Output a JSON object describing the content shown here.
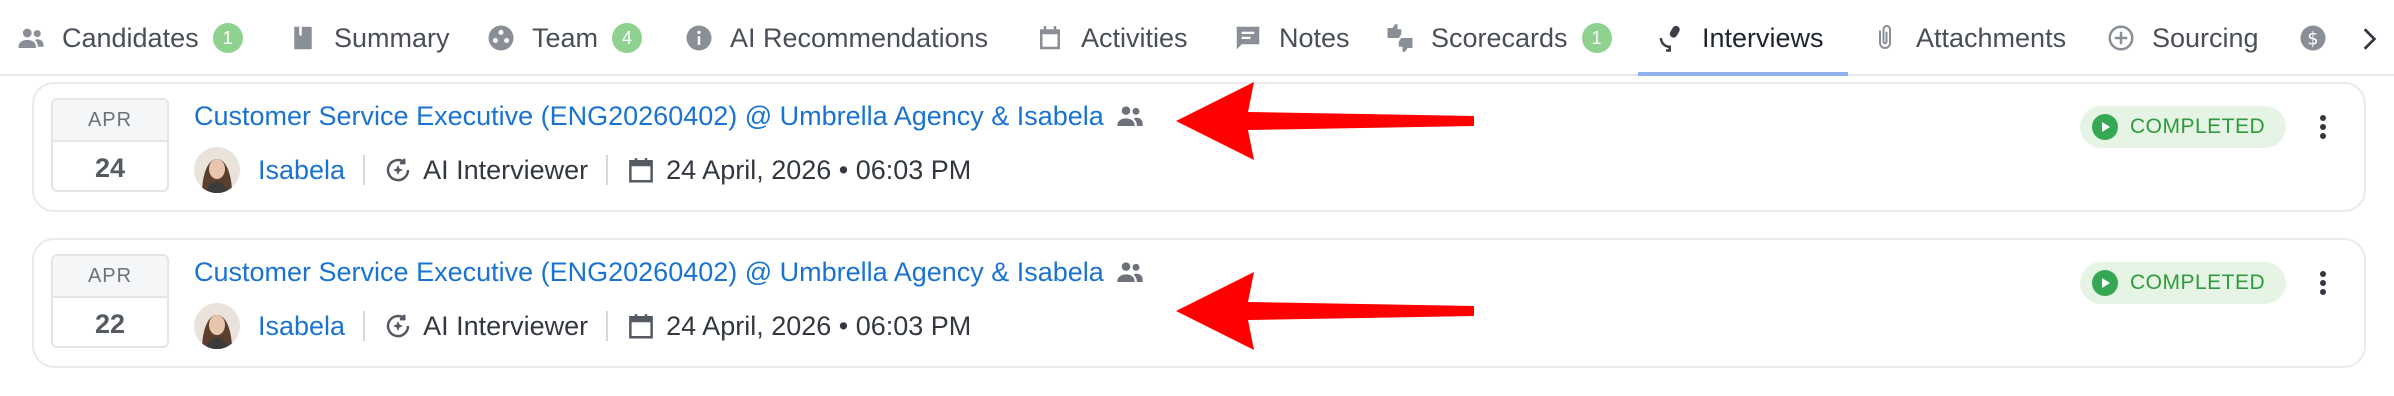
{
  "tabs": [
    {
      "label": "Candidates",
      "badge": "1",
      "icon": "people-icon"
    },
    {
      "label": "Summary",
      "badge": "",
      "icon": "book-icon"
    },
    {
      "label": "Team",
      "badge": "4",
      "icon": "team-icon"
    },
    {
      "label": "AI Recommendations",
      "badge": "",
      "icon": "info-icon"
    },
    {
      "label": "Activities",
      "badge": "",
      "icon": "calendar-icon"
    },
    {
      "label": "Notes",
      "badge": "",
      "icon": "note-icon"
    },
    {
      "label": "Scorecards",
      "badge": "1",
      "icon": "thumbs-icon"
    },
    {
      "label": "Interviews",
      "badge": "",
      "icon": "microphone-icon",
      "active": true
    },
    {
      "label": "Attachments",
      "badge": "",
      "icon": "paperclip-icon"
    },
    {
      "label": "Sourcing",
      "badge": "",
      "icon": "add-circle-icon"
    }
  ],
  "interviews": [
    {
      "month": "APR",
      "day": "24",
      "title": "Customer Service Executive (ENG20260402) @ Umbrella Agency & Isabela",
      "person": "Isabela",
      "interviewer": "AI Interviewer",
      "datetime": "24 April, 2026 • 06:03 PM",
      "status": "COMPLETED"
    },
    {
      "month": "APR",
      "day": "22",
      "title": "Customer Service Executive (ENG20260402) @ Umbrella Agency & Isabela",
      "person": "Isabela",
      "interviewer": "AI Interviewer",
      "datetime": "24 April, 2026 • 06:03 PM",
      "status": "COMPLETED"
    }
  ],
  "colors": {
    "accent": "#1a73d1",
    "badge": "#8fd18f",
    "status_bg": "#e6f4e6",
    "status_text": "#2f9a3c",
    "arrow": "#ff0000"
  }
}
